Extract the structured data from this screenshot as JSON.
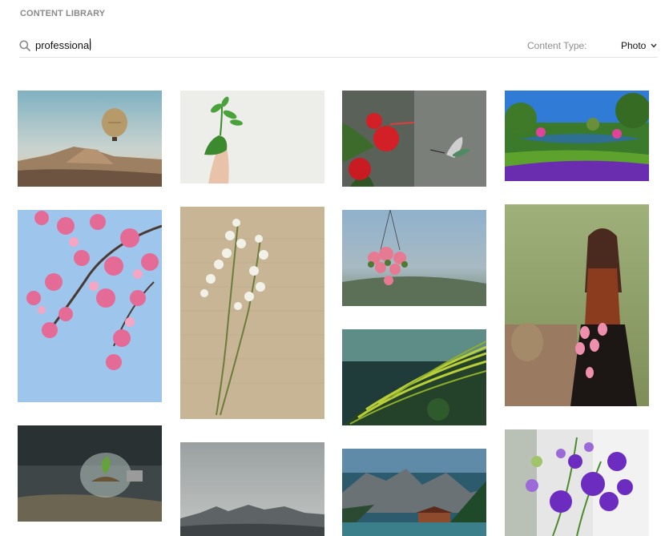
{
  "header": {
    "title": "CONTENT LIBRARY"
  },
  "search": {
    "value": "professional"
  },
  "filter": {
    "label": "Content Type:",
    "value": "Photo"
  },
  "accent_colors": {
    "label_gray": "#8a8a8a",
    "divider": "#e3e3e3"
  },
  "photos": [
    {
      "subject": "hot air balloon over desert valley"
    },
    {
      "subject": "hand holding green sprout"
    },
    {
      "subject": "red hibiscus with hummingbird"
    },
    {
      "subject": "lake in flower garden"
    },
    {
      "subject": "pink cherry blossoms against blue sky"
    },
    {
      "subject": "lily of the valley on paper"
    },
    {
      "subject": "hanging basket of pink flowers"
    },
    {
      "subject": "woman holding pink tulips"
    },
    {
      "subject": "terraced rice fields"
    },
    {
      "subject": "seedling inside light bulb"
    },
    {
      "subject": "misty mountain range"
    },
    {
      "subject": "lake with mountains and boathouse"
    },
    {
      "subject": "purple flowers bouquet"
    }
  ]
}
